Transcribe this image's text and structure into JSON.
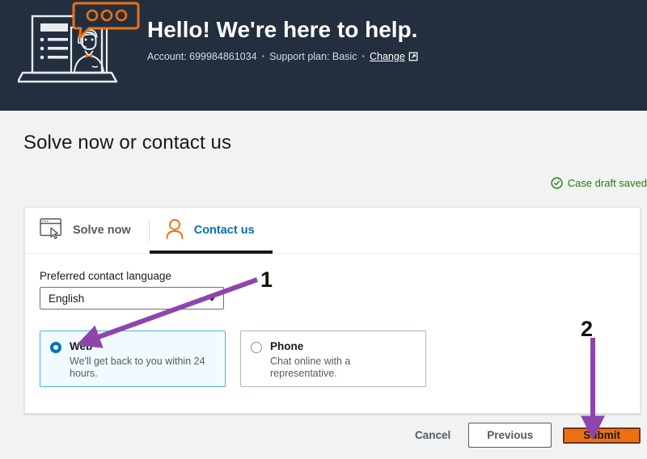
{
  "banner": {
    "title": "Hello!  We're here to help.",
    "account_label": "Account: 699984861034",
    "support_plan_label": "Support plan: Basic",
    "change_link": "Change",
    "separator": "•",
    "illustration_icon": "support-agent-laptop-illustration",
    "external_link_icon": "external-link-icon",
    "background_color": "#232f3e"
  },
  "page": {
    "heading": "Solve now or contact us",
    "background_color": "#f1f3f3"
  },
  "status": {
    "draft_saved_text": "Case draft saved",
    "icon": "check-circle-icon",
    "color": "#1d8102"
  },
  "tabs": [
    {
      "label": "Solve now",
      "icon": "browser-window-cursor-icon",
      "active": false
    },
    {
      "label": "Contact us",
      "icon": "person-icon",
      "active": true
    }
  ],
  "form": {
    "language_field_label": "Preferred contact language",
    "language_value": "English",
    "language_caret_icon": "chevron-down-icon",
    "contact_methods": [
      {
        "title": "Web",
        "description": "We'll get back to you within 24 hours.",
        "selected": true
      },
      {
        "title": "Phone",
        "description": "Chat online with a representative.",
        "selected": false
      }
    ]
  },
  "footer": {
    "cancel_label": "Cancel",
    "previous_label": "Previous",
    "submit_label": "Submit",
    "submit_color": "#ec7211"
  },
  "annotations": {
    "step_one": "1",
    "step_two": "2",
    "arrow_color": "#8e44ad"
  }
}
